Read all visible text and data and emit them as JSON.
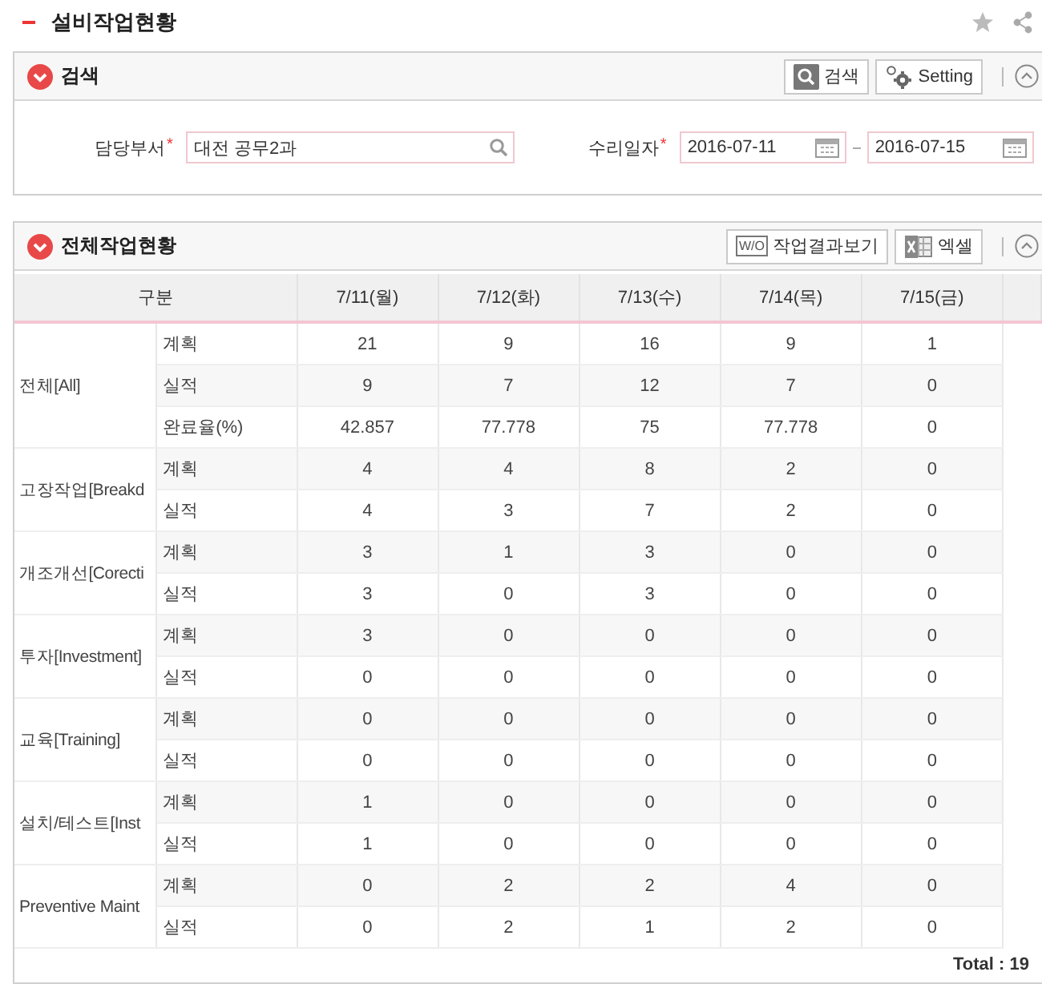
{
  "page": {
    "title": "설비작업현황"
  },
  "search_panel": {
    "title": "검색",
    "buttons": [
      {
        "kind": "search",
        "label": "검색"
      },
      {
        "kind": "setting",
        "label": "Setting"
      }
    ],
    "fields": [
      {
        "kind": "lookup",
        "label": "담당부서",
        "required_mark": "*",
        "value": "대전 공무2과"
      },
      {
        "kind": "daterange",
        "label": "수리일자",
        "required_mark": "*",
        "from": "2016-07-11",
        "to": "2016-07-15"
      }
    ]
  },
  "work_panel": {
    "title": "전체작업현황",
    "buttons": [
      {
        "kind": "wo",
        "label": "작업결과보기",
        "badge": "W/O"
      },
      {
        "kind": "excel",
        "label": "엑셀"
      }
    ],
    "table": {
      "columns": [
        "구분",
        "7/11(월)",
        "7/12(화)",
        "7/13(수)",
        "7/14(목)",
        "7/15(금)"
      ],
      "groups": [
        {
          "label": "전체[All]",
          "rows": [
            {
              "label": "계획",
              "values": [
                "21",
                "9",
                "16",
                "9",
                "1"
              ]
            },
            {
              "label": "실적",
              "values": [
                "9",
                "7",
                "12",
                "7",
                "0"
              ]
            },
            {
              "label": "완료율(%)",
              "values": [
                "42.857",
                "77.778",
                "75",
                "77.778",
                "0"
              ]
            }
          ]
        },
        {
          "label": "고장작업[Breakd",
          "rows": [
            {
              "label": "계획",
              "values": [
                "4",
                "4",
                "8",
                "2",
                "0"
              ]
            },
            {
              "label": "실적",
              "values": [
                "4",
                "3",
                "7",
                "2",
                "0"
              ]
            }
          ]
        },
        {
          "label": "개조개선[Corecti",
          "rows": [
            {
              "label": "계획",
              "values": [
                "3",
                "1",
                "3",
                "0",
                "0"
              ]
            },
            {
              "label": "실적",
              "values": [
                "3",
                "0",
                "3",
                "0",
                "0"
              ]
            }
          ]
        },
        {
          "label": "투자[Investment]",
          "rows": [
            {
              "label": "계획",
              "values": [
                "3",
                "0",
                "0",
                "0",
                "0"
              ]
            },
            {
              "label": "실적",
              "values": [
                "0",
                "0",
                "0",
                "0",
                "0"
              ]
            }
          ]
        },
        {
          "label": "교육[Training]",
          "rows": [
            {
              "label": "계획",
              "values": [
                "0",
                "0",
                "0",
                "0",
                "0"
              ]
            },
            {
              "label": "실적",
              "values": [
                "0",
                "0",
                "0",
                "0",
                "0"
              ]
            }
          ]
        },
        {
          "label": "설치/테스트[Inst",
          "rows": [
            {
              "label": "계획",
              "values": [
                "1",
                "0",
                "0",
                "0",
                "0"
              ]
            },
            {
              "label": "실적",
              "values": [
                "1",
                "0",
                "0",
                "0",
                "0"
              ]
            }
          ]
        },
        {
          "label": "Preventive Maint",
          "rows": [
            {
              "label": "계획",
              "values": [
                "0",
                "2",
                "2",
                "4",
                "0"
              ]
            },
            {
              "label": "실적",
              "values": [
                "0",
                "2",
                "1",
                "2",
                "0"
              ]
            }
          ]
        }
      ]
    },
    "total": "Total : 19"
  }
}
